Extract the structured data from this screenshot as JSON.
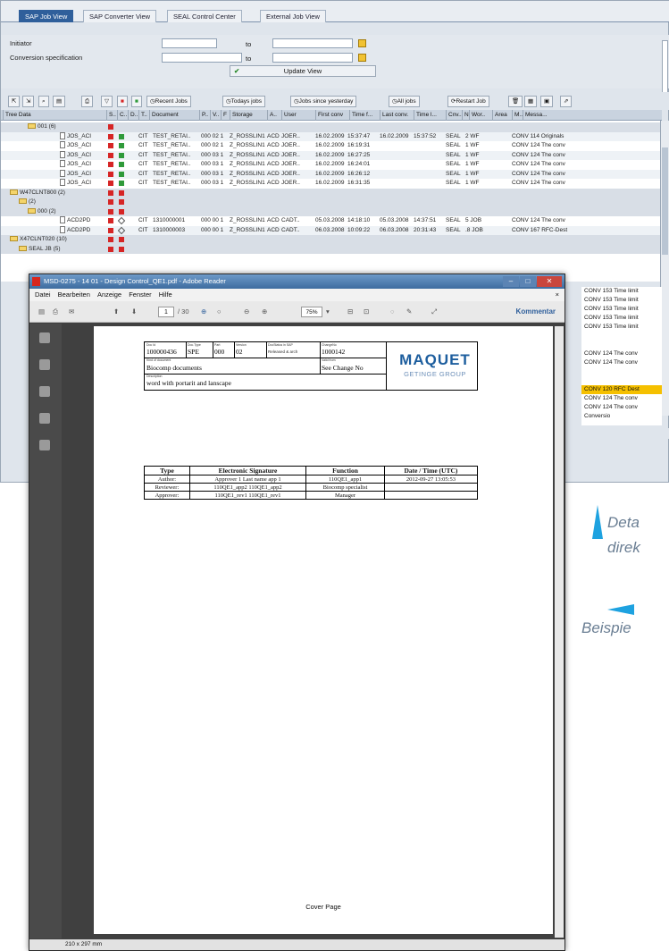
{
  "sap": {
    "tabs": [
      "SAP Job View",
      "SAP Converter View",
      "SEAL Control Center",
      "External Job View"
    ],
    "initiator_label": "Initiator",
    "conv_label": "Conversion specification",
    "to1": "to",
    "to2": "to",
    "update_label": "Update View",
    "toolbar": {
      "recent": "Recent Jobs",
      "today": "Todays jobs",
      "since": "Jobs since yesterday",
      "all": "All jobs",
      "restart": "Restart Job"
    },
    "columns": [
      "Tree Data",
      "S..",
      "C..",
      "D..",
      "T..",
      "Document",
      "P..",
      "V..",
      "F",
      "Storage",
      "A..",
      "User",
      "First conv",
      "Time f...",
      "Last conv.",
      "Time l...",
      "Cnv..",
      "N",
      "Wor..",
      "Area",
      "M..",
      "Messa..."
    ],
    "rows": [
      {
        "tree": "001 (6)",
        "indent": 30,
        "type": "folder"
      },
      {
        "tree": "JOS_ACI",
        "indent": 66,
        "type": "doc",
        "f": "CIT",
        "doc": "TEST_RETAI..",
        "p": "000 02 1",
        "sto": "Z_ROSSLIN1",
        "a": "ACD",
        "user": "JOER..",
        "fc": "16.02.2009",
        "tf": "15:37:47",
        "lc": "16.02.2009",
        "tl": "15:37:52",
        "cnv": "SEAL",
        "n": "2 WF",
        "area": "CONV 114 Originals"
      },
      {
        "tree": "JOS_ACI",
        "indent": 66,
        "type": "doc",
        "f": "CIT",
        "doc": "TEST_RETAI..",
        "p": "000 02 1",
        "sto": "Z_ROSSLIN1",
        "a": "ACD",
        "user": "JOER..",
        "fc": "16.02.2009",
        "tf": "16:19:31",
        "lc": "",
        "tl": "",
        "cnv": "SEAL",
        "n": "1 WF",
        "area": "CONV 124 The conv"
      },
      {
        "tree": "JOS_ACI",
        "indent": 66,
        "type": "doc",
        "f": "CIT",
        "doc": "TEST_RETAI..",
        "p": "000 03 1",
        "sto": "Z_ROSSLIN1",
        "a": "ACD",
        "user": "JOER..",
        "fc": "16.02.2009",
        "tf": "16:27:25",
        "lc": "",
        "tl": "",
        "cnv": "SEAL",
        "n": "1 WF",
        "area": "CONV 124 The conv"
      },
      {
        "tree": "JOS_ACI",
        "indent": 66,
        "type": "doc",
        "f": "CIT",
        "doc": "TEST_RETAI..",
        "p": "000 03 1",
        "sto": "Z_ROSSLIN1",
        "a": "ACD",
        "user": "JOER..",
        "fc": "16.02.2009",
        "tf": "16:24:01",
        "lc": "",
        "tl": "",
        "cnv": "SEAL",
        "n": "1 WF",
        "area": "CONV 124 The conv"
      },
      {
        "tree": "JOS_ACI",
        "indent": 66,
        "type": "doc",
        "f": "CIT",
        "doc": "TEST_RETAI..",
        "p": "000 03 1",
        "sto": "Z_ROSSLIN1",
        "a": "ACD",
        "user": "JOER..",
        "fc": "16.02.2009",
        "tf": "16:26:12",
        "lc": "",
        "tl": "",
        "cnv": "SEAL",
        "n": "1 WF",
        "area": "CONV 124 The conv"
      },
      {
        "tree": "JOS_ACI",
        "indent": 66,
        "type": "doc",
        "f": "CIT",
        "doc": "TEST_RETAI..",
        "p": "000 03 1",
        "sto": "Z_ROSSLIN1",
        "a": "ACD",
        "user": "JOER..",
        "fc": "16.02.2009",
        "tf": "16:31:35",
        "lc": "",
        "tl": "",
        "cnv": "SEAL",
        "n": "1 WF",
        "area": "CONV 124 The conv"
      },
      {
        "tree": "W47CLNT800 (2)",
        "indent": 10,
        "type": "folder"
      },
      {
        "tree": "(2)",
        "indent": 20,
        "type": "folder"
      },
      {
        "tree": "000 (2)",
        "indent": 30,
        "type": "folder"
      },
      {
        "tree": "ACD2PD",
        "indent": 66,
        "type": "doc2",
        "f": "CIT",
        "doc": "1310000001",
        "p": "000 00 1",
        "sto": "Z_ROSSLIN1",
        "a": "ACD",
        "user": "CADT..",
        "fc": "05.03.2008",
        "tf": "14:18:10",
        "lc": "05.03.2008",
        "tl": "14:37:51",
        "cnv": "SEAL",
        "n": "5 JOB",
        "area": "CONV 124 The conv"
      },
      {
        "tree": "ACD2PD",
        "indent": 66,
        "type": "doc2",
        "f": "CIT",
        "doc": "1310000003",
        "p": "000 00 1",
        "sto": "Z_ROSSLIN1",
        "a": "ACD",
        "user": "CADT..",
        "fc": "06.03.2008",
        "tf": "10:09:22",
        "lc": "06.03.2008",
        "tl": "20:31:43",
        "cnv": "SEAL",
        "n": ".8 JOB",
        "area": "CONV 167 RFC-Dest"
      },
      {
        "tree": "X47CLNT020 (10)",
        "indent": 10,
        "type": "folder"
      },
      {
        "tree": "SEAL JB (5)",
        "indent": 20,
        "type": "folder"
      }
    ],
    "messages": [
      {
        "t": "CONV 153 Time limit",
        "hl": false
      },
      {
        "t": "CONV 153 Time limit",
        "hl": false
      },
      {
        "t": "CONV 153 Time limit",
        "hl": false
      },
      {
        "t": "CONV 153 Time limit",
        "hl": false
      },
      {
        "t": "CONV 153 Time limit",
        "hl": false
      },
      {
        "t": "",
        "hl": false
      },
      {
        "t": "",
        "hl": false
      },
      {
        "t": "CONV 124 The conv",
        "hl": false
      },
      {
        "t": "CONV 124 The conv",
        "hl": false
      },
      {
        "t": "",
        "hl": false
      },
      {
        "t": "",
        "hl": false
      },
      {
        "t": "CONV 120 RFC Dest",
        "hl": true
      },
      {
        "t": "CONV 124 The conv",
        "hl": false
      },
      {
        "t": "CONV 124 The conv",
        "hl": false
      },
      {
        "t": "Conversio",
        "hl": false
      }
    ]
  },
  "pdf": {
    "title": "MSD-0275 - 14 01 - Design Control_QE1.pdf - Adobe Reader",
    "menu": [
      "Datei",
      "Bearbeiten",
      "Anzeige",
      "Fenster",
      "Hilfe"
    ],
    "page": "1",
    "pages": "/ 30",
    "zoom": "75%",
    "kommentar": "Kommentar",
    "status": "210 x 297 mm",
    "header": {
      "doc_id_lbl": "Doc Id",
      "doc_id": "100000436",
      "doc_type_lbl": "Doc.Type",
      "doc_type": "SPE",
      "part_lbl": "Part",
      "part": "000",
      "version_lbl": "Version",
      "version": "02",
      "docstatus_lbl": "DocStatus in SAP",
      "docstatus": "Released & arch",
      "change_lbl": "ChangeNo",
      "change": "1000142",
      "kind_lbl": "Kind of document",
      "kind": "Biocomp documents",
      "valid_lbl": "Valid from",
      "valid": "See Change No",
      "desc_lbl": "Description",
      "desc": "word with portarit and lanscape"
    },
    "logo": {
      "main": "MAQUET",
      "sub": "GETINGE GROUP"
    },
    "sig": {
      "head": [
        "Type",
        "Electronic Signature",
        "Function",
        "Date / Time (UTC)"
      ],
      "rows": [
        [
          "Author:",
          "Approver 1 Last name app 1",
          "110QE1_app1",
          "2012-09-27 13:05:53"
        ],
        [
          "Reviewer:",
          "110QE1_app2 110QE1_app2",
          "Biocomp specialist",
          ""
        ],
        [
          "Approver:",
          "110QE1_rev1 110QE1_rev1",
          "Manager",
          ""
        ]
      ]
    },
    "cover": "Cover Page"
  },
  "side": {
    "text1a": "Deta",
    "text1b": "direk",
    "text2": "Beispie"
  },
  "colors": {
    "accent": "#1ea2e0",
    "tab_active": "#2f5f9b",
    "highlight": "#f5c000"
  }
}
